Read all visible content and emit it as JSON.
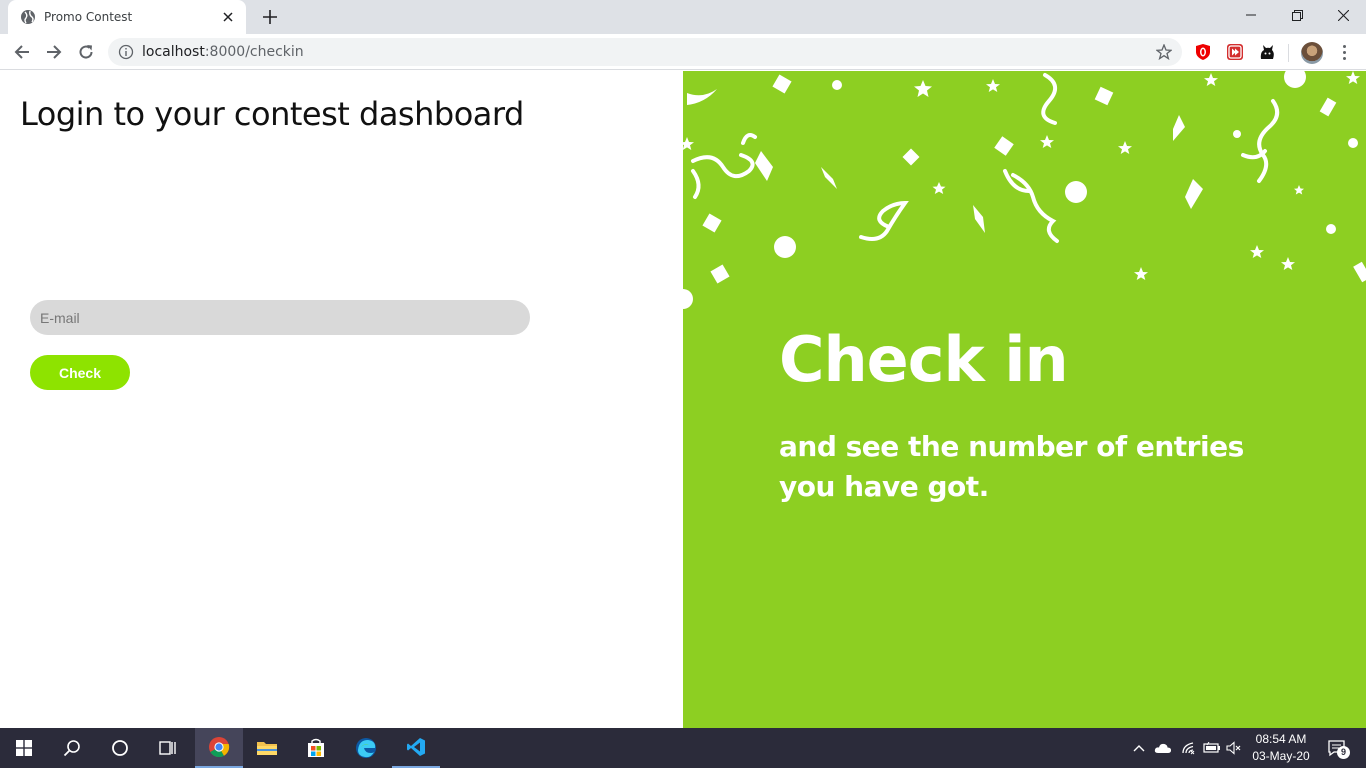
{
  "browser": {
    "tab_title": "Promo Contest",
    "url_host": "localhost",
    "url_path": ":8000/checkin",
    "icons": {
      "favicon": "globe-icon",
      "close": "close-icon",
      "new_tab": "plus-icon",
      "back": "arrow-left-icon",
      "forward": "arrow-right-icon",
      "reload": "reload-icon",
      "info": "info-icon",
      "bookmark": "star-icon",
      "ext1": "opera-shield-icon",
      "ext2": "red-play-extension-icon",
      "ext3": "github-cat-icon",
      "menu": "kebab-menu-icon"
    }
  },
  "page": {
    "heading": "Login to your contest dashboard",
    "email_placeholder": "E-mail",
    "email_value": "",
    "check_label": "Check",
    "hero_title": "Check in",
    "hero_subtitle": "and see the number of entries you have got.",
    "colors": {
      "accent": "#8ee300",
      "hero_bg": "#8dcf22",
      "input_bg": "#d9d9d9"
    }
  },
  "taskbar": {
    "apps": [
      "windows-start-icon",
      "search-icon",
      "cortana-icon",
      "task-view-icon",
      "chrome-icon",
      "file-explorer-icon",
      "store-icon",
      "edge-icon",
      "vscode-icon"
    ],
    "time": "08:54 AM",
    "date": "03-May-20",
    "notification_count": "9"
  }
}
